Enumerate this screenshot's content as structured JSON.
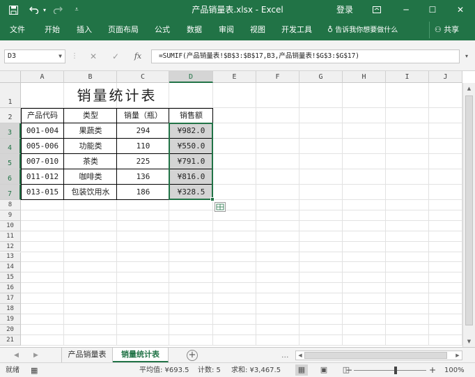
{
  "titlebar": {
    "title": "产品销量表.xlsx  -  Excel",
    "login": "登录",
    "icons": [
      "save-icon",
      "undo-icon",
      "redo-icon",
      "customize-qat-icon",
      "ribbon-display-icon",
      "minimize-icon",
      "maximize-icon",
      "close-icon"
    ]
  },
  "ribbon": {
    "tabs": [
      "文件",
      "开始",
      "插入",
      "页面布局",
      "公式",
      "数据",
      "审阅",
      "视图",
      "开发工具"
    ],
    "tell_me": "告诉我你想要做什么",
    "share": "共享"
  },
  "formula_bar": {
    "name_box": "D3",
    "formula": "=SUMIF(产品销量表!$B$3:$B$17,B3,产品销量表!$G$3:$G$17)"
  },
  "sheet": {
    "columns": [
      "A",
      "B",
      "C",
      "D",
      "E",
      "F",
      "G",
      "H",
      "I",
      "J"
    ],
    "rows": [
      "1",
      "2",
      "3",
      "4",
      "5",
      "6",
      "7",
      "8",
      "9",
      "10",
      "11",
      "12",
      "13",
      "14",
      "15",
      "16",
      "17",
      "18",
      "19",
      "20",
      "21"
    ],
    "selected_col": "D",
    "title": "销量统计表",
    "headers": [
      "产品代码",
      "类型",
      "销量（瓶）",
      "销售额"
    ],
    "data": [
      [
        "001-004",
        "果蔬类",
        "294",
        "¥982.0"
      ],
      [
        "005-006",
        "功能类",
        "110",
        "¥550.0"
      ],
      [
        "007-010",
        "茶类",
        "225",
        "¥791.0"
      ],
      [
        "011-012",
        "咖啡类",
        "136",
        "¥816.0"
      ],
      [
        "013-015",
        "包装饮用水",
        "186",
        "¥328.5"
      ]
    ]
  },
  "sheet_tabs": {
    "tabs": [
      "产品销量表",
      "销量统计表"
    ],
    "active": 1,
    "ellipsis": "..."
  },
  "status_bar": {
    "mode": "就绪",
    "average": "平均值: ¥693.5",
    "count": "计数: 5",
    "sum": "求和: ¥3,467.5",
    "zoom": "100%",
    "zoom_minus": "−",
    "zoom_plus": "+"
  },
  "colors": {
    "accent": "#217346",
    "selected_fill": "#d4d4d4"
  }
}
